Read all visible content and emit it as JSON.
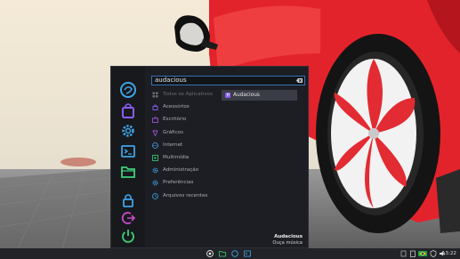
{
  "search": {
    "value": "audacious"
  },
  "categories": [
    {
      "label": "Todos os Aplicativos",
      "icon": "grid-icon",
      "dim": true
    },
    {
      "label": "Acessórios",
      "icon": "bag-icon",
      "dim": false
    },
    {
      "label": "Escritório",
      "icon": "briefcase-icon",
      "dim": false
    },
    {
      "label": "Gráficos",
      "icon": "palette-icon",
      "dim": false
    },
    {
      "label": "Internet",
      "icon": "globe-icon",
      "dim": false
    },
    {
      "label": "Multimídia",
      "icon": "play-icon",
      "dim": false
    },
    {
      "label": "Administração",
      "icon": "gear-icon",
      "dim": false
    },
    {
      "label": "Preferências",
      "icon": "gear-icon",
      "dim": false
    },
    {
      "label": "Arquivos recentes",
      "icon": "clock-icon",
      "dim": false
    }
  ],
  "result": {
    "label": "Audacious",
    "icon": "music-note-icon"
  },
  "selected_app": {
    "name": "Audacious",
    "description": "Ouça música"
  },
  "clock": "13:22",
  "colors": {
    "accent": "#3b6fb8",
    "panel": "#1c1e23",
    "sidebar": "#17191d",
    "taskbar": "#212328"
  }
}
